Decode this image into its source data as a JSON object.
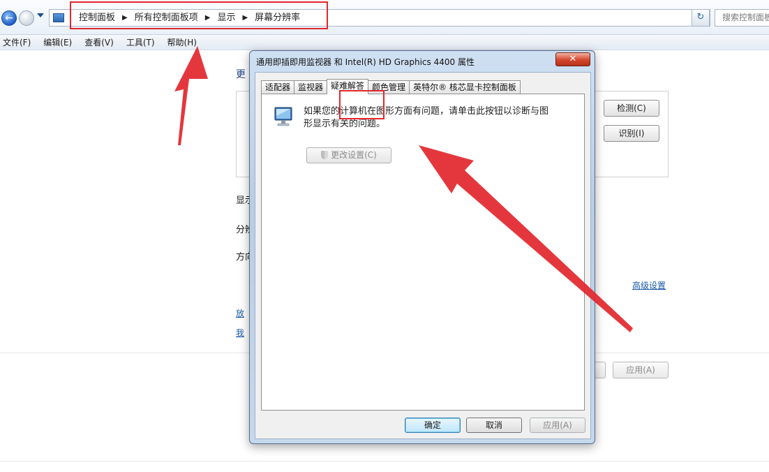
{
  "explorer": {
    "breadcrumbs": [
      "控制面板",
      "所有控制面板项",
      "显示",
      "屏幕分辨率"
    ],
    "search_placeholder": "搜索控制面板",
    "menu": [
      "文件(F)",
      "编辑(E)",
      "查看(V)",
      "工具(T)",
      "帮助(H)"
    ]
  },
  "background_panel": {
    "heading": "更",
    "detect_button": "检测(C)",
    "identify_button": "识别(I)",
    "labels": [
      "显示",
      "分辨",
      "方向"
    ],
    "advanced_link": "高级设置",
    "links": [
      "放",
      "我"
    ],
    "apply_button": "应用(A)"
  },
  "dialog": {
    "title": "通用即插即用监视器 和 Intel(R) HD Graphics 4400 属性",
    "close_label": "✕",
    "tabs": [
      "适配器",
      "监视器",
      "疑难解答",
      "颜色管理",
      "英特尔® 核芯显卡控制面板"
    ],
    "active_tab_index": 2,
    "description": "如果您的计算机在图形方面有问题，请单击此按钮以诊断与图形显示有关的问题。",
    "change_settings_button": "更改设置(C)",
    "ok_button": "确定",
    "cancel_button": "取消",
    "apply_button": "应用(A)"
  },
  "colors": {
    "annotation": "#e2262d",
    "link": "#1a5aa8"
  }
}
